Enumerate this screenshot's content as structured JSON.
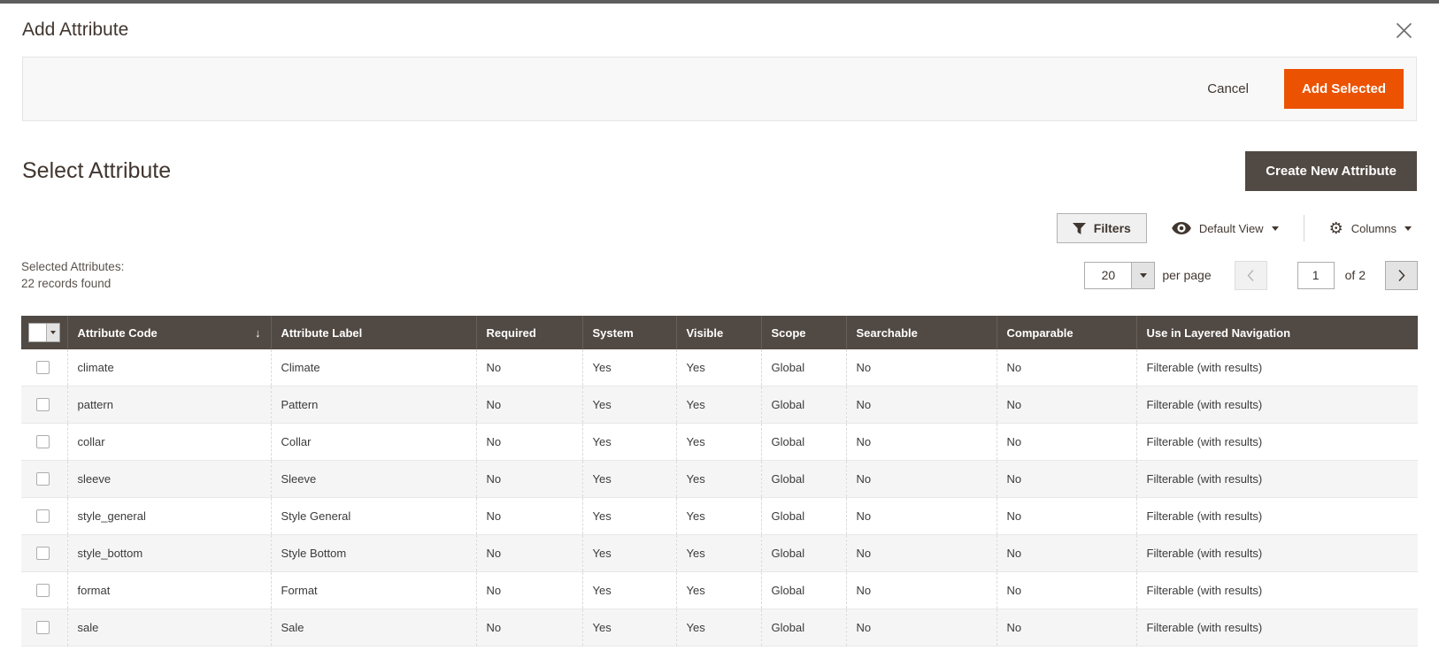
{
  "modal": {
    "title": "Add Attribute",
    "cancel_label": "Cancel",
    "add_selected_label": "Add Selected"
  },
  "section": {
    "title": "Select Attribute",
    "create_button_label": "Create New Attribute"
  },
  "toolbar": {
    "filters_label": "Filters",
    "view_label": "Default View",
    "columns_label": "Columns"
  },
  "status": {
    "line1": "Selected Attributes:",
    "line2": "22 records found"
  },
  "pagination": {
    "page_size": "20",
    "per_page_label": "per page",
    "current_page": "1",
    "total_pages_label": "of 2"
  },
  "icons": {
    "close": "close-icon",
    "filters": "filter-funnel-icon",
    "default_view": "eye-icon",
    "columns": "gear-icon",
    "gear_glyph": "⚙",
    "prev": "chevron-left-icon",
    "next": "chevron-right-icon",
    "select_all": "checkbox-dropdown-icon",
    "sort_desc_glyph": "↓"
  },
  "colors": {
    "accent_orange": "#eb5202",
    "dark_brown": "#514943",
    "grid_header_bg": "#514943",
    "stripe_row_bg": "#f5f5f5"
  },
  "table": {
    "sort_arrow": "↓",
    "sorted_column": "code",
    "columns": [
      {
        "key": "code",
        "label": "Attribute Code"
      },
      {
        "key": "label",
        "label": "Attribute Label"
      },
      {
        "key": "required",
        "label": "Required"
      },
      {
        "key": "system",
        "label": "System"
      },
      {
        "key": "visible",
        "label": "Visible"
      },
      {
        "key": "scope",
        "label": "Scope"
      },
      {
        "key": "searchable",
        "label": "Searchable"
      },
      {
        "key": "comparable",
        "label": "Comparable"
      },
      {
        "key": "layered",
        "label": "Use in Layered Navigation"
      }
    ],
    "rows": [
      {
        "checked": false,
        "code": "climate",
        "label": "Climate",
        "required": "No",
        "system": "Yes",
        "visible": "Yes",
        "scope": "Global",
        "searchable": "No",
        "comparable": "No",
        "layered": "Filterable (with results)"
      },
      {
        "checked": false,
        "code": "pattern",
        "label": "Pattern",
        "required": "No",
        "system": "Yes",
        "visible": "Yes",
        "scope": "Global",
        "searchable": "No",
        "comparable": "No",
        "layered": "Filterable (with results)"
      },
      {
        "checked": false,
        "code": "collar",
        "label": "Collar",
        "required": "No",
        "system": "Yes",
        "visible": "Yes",
        "scope": "Global",
        "searchable": "No",
        "comparable": "No",
        "layered": "Filterable (with results)"
      },
      {
        "checked": false,
        "code": "sleeve",
        "label": "Sleeve",
        "required": "No",
        "system": "Yes",
        "visible": "Yes",
        "scope": "Global",
        "searchable": "No",
        "comparable": "No",
        "layered": "Filterable (with results)"
      },
      {
        "checked": false,
        "code": "style_general",
        "label": "Style General",
        "required": "No",
        "system": "Yes",
        "visible": "Yes",
        "scope": "Global",
        "searchable": "No",
        "comparable": "No",
        "layered": "Filterable (with results)"
      },
      {
        "checked": false,
        "code": "style_bottom",
        "label": "Style Bottom",
        "required": "No",
        "system": "Yes",
        "visible": "Yes",
        "scope": "Global",
        "searchable": "No",
        "comparable": "No",
        "layered": "Filterable (with results)"
      },
      {
        "checked": false,
        "code": "format",
        "label": "Format",
        "required": "No",
        "system": "Yes",
        "visible": "Yes",
        "scope": "Global",
        "searchable": "No",
        "comparable": "No",
        "layered": "Filterable (with results)"
      },
      {
        "checked": false,
        "code": "sale",
        "label": "Sale",
        "required": "No",
        "system": "Yes",
        "visible": "Yes",
        "scope": "Global",
        "searchable": "No",
        "comparable": "No",
        "layered": "Filterable (with results)"
      }
    ]
  }
}
